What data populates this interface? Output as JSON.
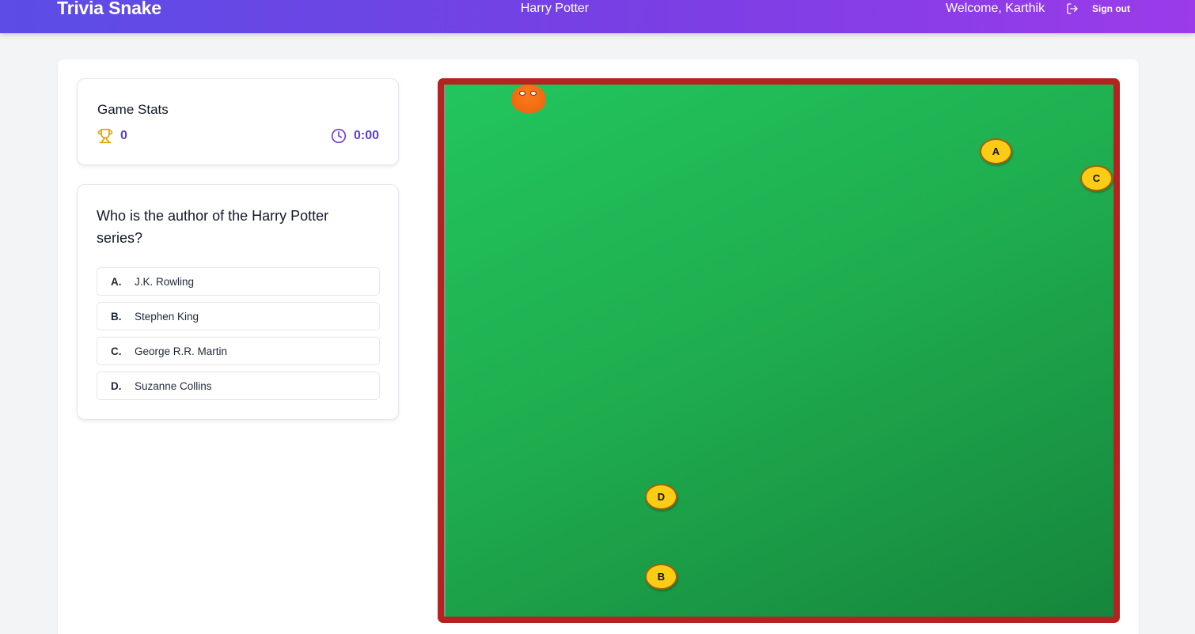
{
  "header": {
    "brand": "Trivia Snake",
    "topic": "Harry Potter",
    "welcome": "Welcome, Karthik",
    "signout_label": "Sign out",
    "signout_icon": "logout-icon"
  },
  "stats": {
    "title": "Game Stats",
    "score": "0",
    "score_icon": "trophy-icon",
    "time": "0:00",
    "time_icon": "clock-icon"
  },
  "question": {
    "text": "Who is the author of the Harry Potter series?",
    "options": [
      {
        "letter": "A.",
        "text": "J.K. Rowling"
      },
      {
        "letter": "B.",
        "text": "Stephen King"
      },
      {
        "letter": "C.",
        "text": "George R.R. Martin"
      },
      {
        "letter": "D.",
        "text": "Suzanne Collins"
      }
    ]
  },
  "board": {
    "food": [
      {
        "label": "A"
      },
      {
        "label": "C"
      },
      {
        "label": "D"
      },
      {
        "label": "B"
      }
    ]
  },
  "colors": {
    "header_gradient_start": "#5b4de6",
    "header_gradient_end": "#9b3bea",
    "accent": "#5b3fd6",
    "board_border": "#b4231f",
    "board_green": "#1fae4f",
    "snake": "#f06a10",
    "food": "#facc15"
  }
}
